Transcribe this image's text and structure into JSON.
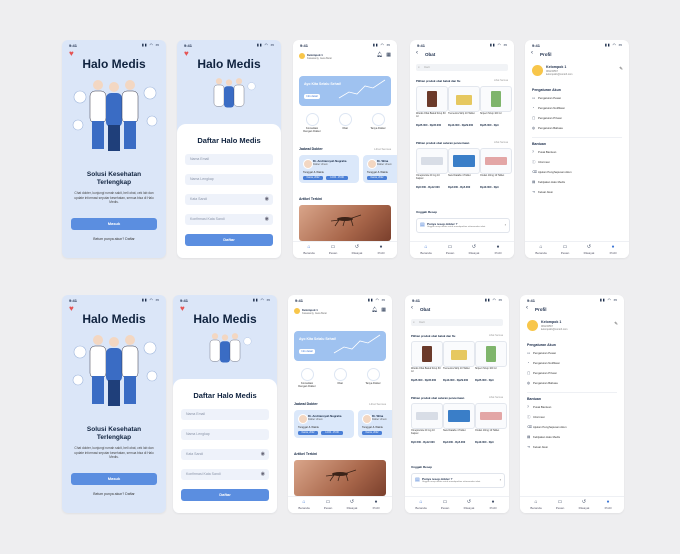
{
  "status": {
    "time": "9:41",
    "signal": "▮▮ ◠ ▭"
  },
  "splash": {
    "app_title": "Halo Medis",
    "headline": "Solusi Kesehatan Terlengkap",
    "description": "Chat dokter, kunjungi rumah sakit, beli obat, cek lab dan update informasi seputar kesehatan, semua bisa di Halo Medis.",
    "login_button": "Masuk",
    "register_prompt": "Belum punya akun? Daftar"
  },
  "register": {
    "app_title": "Halo Medis",
    "sheet_title": "Daftar Halo Medis",
    "fields": [
      "Nama Email",
      "Nama Lengkap",
      "Kata Sandi",
      "Konfirmasi Kata Sandi"
    ],
    "submit_button": "Daftar"
  },
  "home": {
    "location_title": "Kelompok 1",
    "location_sub": "Kawasanty, Jawa Barat",
    "banner_text": "Ayo Kita Selalu Sehat!",
    "banner_button": "Info detail",
    "categories": [
      "Konsultasi Dengan Dokter",
      "Obat",
      "Tanya Dokter"
    ],
    "jadwal_title": "Jadwal Dokter",
    "see_all": "Lihat Semua",
    "doctors": [
      {
        "name": "Dr. Andriansyah Nugraha",
        "spec": "Dokter Umum",
        "date": "Tanggal & Waktu",
        "pill1": "Kamis, 2022",
        "pill2": "14:00 - 15:00"
      },
      {
        "name": "Dr. Wina",
        "spec": "Dokter Umum",
        "date": "Tanggal & Waktu",
        "pill1": "Kamis, 2022",
        "pill2": "14:00"
      }
    ],
    "artikel_title": "Artikel Terkini",
    "nav": [
      "Beranda",
      "Pesan",
      "Riwayat",
      "Profil"
    ]
  },
  "obat": {
    "title": "Obat",
    "search_placeholder": "Cari",
    "section1": "Pilihan produk obat batuk dan flu",
    "section2": "Pilihan produk obat saluran pencernaan",
    "see_all": "Lihat Semua",
    "products1": [
      {
        "name": "Woods Obat Batuk Sirup 60 ml",
        "price": "Rp25.000 - Rp35.000"
      },
      {
        "name": "Tremenza Strip 10 Tablet",
        "price": "Rp13.000 - Rp29.000"
      },
      {
        "name": "Sirpect Sirup 100 ml",
        "price": "Rp25.000 - Rp3"
      }
    ],
    "products2": [
      {
        "name": "Omeprazole 20 mg 10 Kapsul",
        "price": "Rp5.500 - Rp12.000"
      },
      {
        "name": "New Diatabs 4 Tablet",
        "price": "Rp3.000 - Rp5.000"
      },
      {
        "name": "Ondan 10mg 10 Tablet",
        "price": "Rp10.000 - Rp3"
      }
    ],
    "upload_title": "Unggah Resep",
    "upload_card_title": "Punya resep dokter ?",
    "upload_card_sub": "Unggah resep dokter untuk mendapatkan rekomendasi obat",
    "nav": [
      "Beranda",
      "Pesan",
      "Riwayat",
      "Profil"
    ]
  },
  "profil": {
    "title": "Profil",
    "name": "Kelompok 1",
    "phone": "081234567",
    "email": "kelompok1@contoh.com",
    "account_section": "Pengaturan Akun",
    "account_items": [
      "Pengaturan Pesan",
      "Pengaturan Notifikasi",
      "Pengaturan Privasi",
      "Pengaturan Bahasa"
    ],
    "help_section": "Bantuan",
    "help_items": [
      "Pusat Bantuan",
      "Informasi",
      "Ajukan Penghapusan Akun",
      "Kebijakan Halo Medis",
      "Keluar Akun"
    ],
    "nav": [
      "Beranda",
      "Pesan",
      "Riwayat",
      "Profil"
    ]
  },
  "colors": {
    "primary": "#5b8ee0",
    "bg_blue": "#dbe6f8",
    "text_dark": "#10233f"
  }
}
